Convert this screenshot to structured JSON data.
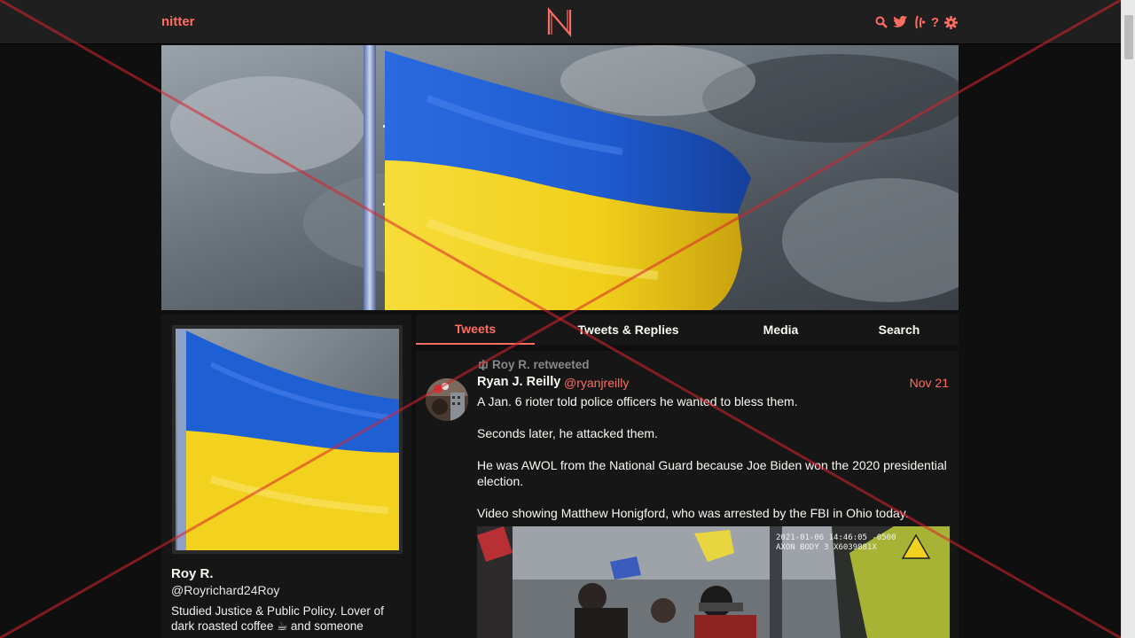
{
  "nav": {
    "brand": "nitter",
    "icons": [
      "search-icon",
      "twitter-icon",
      "rss-icon",
      "help-icon",
      "gear-icon"
    ],
    "help_glyph": "?"
  },
  "profile": {
    "fullname": "Roy R.",
    "username": "@Royrichard24Roy",
    "bio": "Studied Justice & Public Policy.   Lover of dark roasted coffee ☕  and someone"
  },
  "tabs": [
    {
      "label": "Tweets",
      "active": true
    },
    {
      "label": "Tweets & Replies",
      "active": false
    },
    {
      "label": "Media",
      "active": false
    },
    {
      "label": "Search",
      "active": false
    }
  ],
  "tweet": {
    "retweet_label": "Roy R. retweeted",
    "fullname": "Ryan J. Reilly",
    "username": "@ryanjreilly",
    "date": "Nov 21",
    "paragraphs": [
      "A Jan. 6 rioter told police officers he wanted to bless them.",
      "Seconds later, he attacked them.",
      "He was AWOL from the National Guard because Joe Biden won the 2020 presidential election.",
      "Video showing Matthew Honigford, who was arrested by the FBI in Ohio today."
    ],
    "media_timestamp": "2021-01-06 14:46:05 -0500",
    "media_device": "AXON BODY 3 X6039881X"
  },
  "colors": {
    "accent": "#ff6c60",
    "background": "#0f0f0f",
    "nav_bg": "#1f1f1f",
    "card_bg": "#161616",
    "flag_blue": "#1f63d6",
    "flag_yellow": "#f4d21e"
  }
}
